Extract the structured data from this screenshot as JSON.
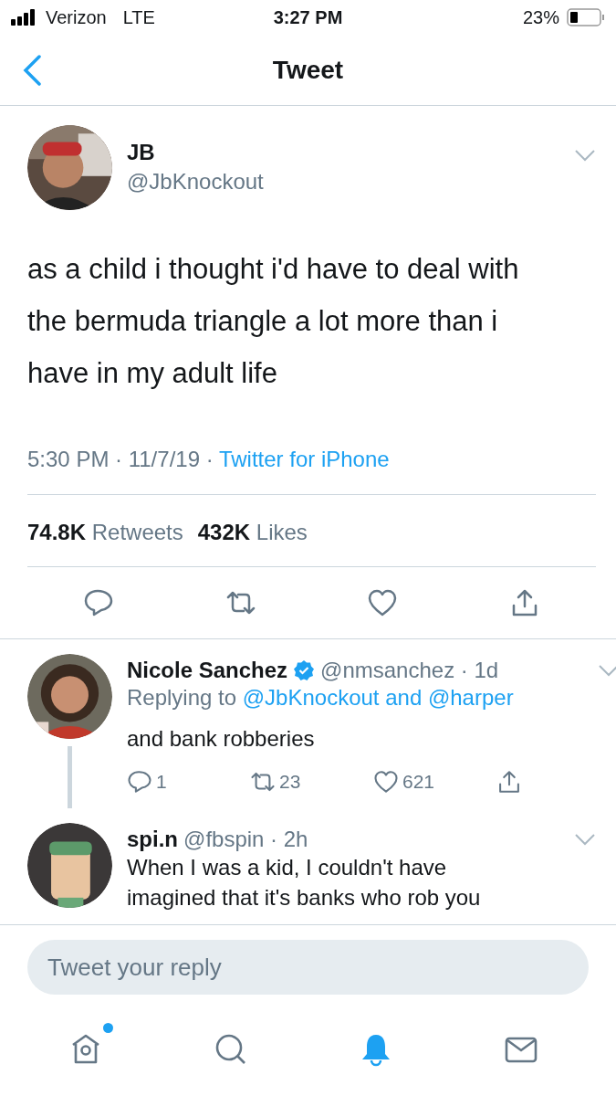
{
  "status_bar": {
    "carrier": "Verizon",
    "network": "LTE",
    "time": "3:27 PM",
    "battery": "23%"
  },
  "nav": {
    "title": "Tweet"
  },
  "tweet": {
    "name": "JB",
    "handle": "@JbKnockout",
    "text": "as a child i thought i'd have to deal with the bermuda triangle a lot more than i have in my adult life",
    "time": "5:30 PM · 11/7/19 · ",
    "source": "Twitter for iPhone",
    "retweets": "74.8K",
    "retweets_label": "Retweets",
    "likes": "432K",
    "likes_label": "Likes"
  },
  "replies": [
    {
      "name": "Nicole Sanchez",
      "verified": true,
      "handle": "@nmsanchez · 1d",
      "replying_label": "Replying to",
      "replying_to": "@JbKnockout and @harper",
      "text": "and bank robberies",
      "reply_count": "1",
      "retweet_count": "23",
      "like_count": "621",
      "thread_line": true
    },
    {
      "name": "spi.n",
      "verified": false,
      "handle": "@fbspin · 2h",
      "text": "When I was a kid, I couldn't have imagined that it's banks who rob you",
      "thread_line": false
    }
  ],
  "reply_field": {
    "placeholder": "Tweet your reply"
  },
  "tab_bar": [
    {
      "kind": "home",
      "selected": false,
      "dot": true
    },
    {
      "kind": "search",
      "selected": false,
      "dot": false
    },
    {
      "kind": "notifications",
      "selected": true,
      "dot": false
    },
    {
      "kind": "messages",
      "selected": false,
      "dot": false
    }
  ]
}
